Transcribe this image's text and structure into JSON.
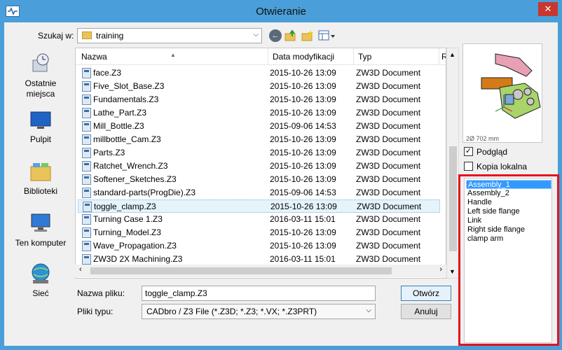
{
  "window": {
    "title": "Otwieranie",
    "close_glyph": "✕",
    "icon": "zw3d-app-icon"
  },
  "toolbar": {
    "look_in_label": "Szukaj w:",
    "look_in_value": "training"
  },
  "places": [
    {
      "label": "Ostatnie\nmiejsca",
      "icon": "recent-places-icon"
    },
    {
      "label": "Pulpit",
      "icon": "desktop-icon"
    },
    {
      "label": "Biblioteki",
      "icon": "libraries-icon"
    },
    {
      "label": "Ten komputer",
      "icon": "computer-icon"
    },
    {
      "label": "Sieć",
      "icon": "network-icon"
    }
  ],
  "file_list": {
    "columns": [
      "Nazwa",
      "Data modyfikacji",
      "Typ",
      "R"
    ],
    "rows": [
      {
        "name": "face.Z3",
        "date": "2015-10-26 13:09",
        "type": "ZW3D Document"
      },
      {
        "name": "Five_Slot_Base.Z3",
        "date": "2015-10-26 13:09",
        "type": "ZW3D Document"
      },
      {
        "name": "Fundamentals.Z3",
        "date": "2015-10-26 13:09",
        "type": "ZW3D Document"
      },
      {
        "name": "Lathe_Part.Z3",
        "date": "2015-10-26 13:09",
        "type": "ZW3D Document"
      },
      {
        "name": "Mill_Bottle.Z3",
        "date": "2015-09-06 14:53",
        "type": "ZW3D Document"
      },
      {
        "name": "millbottle_Cam.Z3",
        "date": "2015-10-26 13:09",
        "type": "ZW3D Document"
      },
      {
        "name": "Parts.Z3",
        "date": "2015-10-26 13:09",
        "type": "ZW3D Document"
      },
      {
        "name": "Ratchet_Wrench.Z3",
        "date": "2015-10-26 13:09",
        "type": "ZW3D Document"
      },
      {
        "name": "Softener_Sketches.Z3",
        "date": "2015-10-26 13:09",
        "type": "ZW3D Document"
      },
      {
        "name": "standard-parts(ProgDie).Z3",
        "date": "2015-09-06 14:53",
        "type": "ZW3D Document"
      },
      {
        "name": "toggle_clamp.Z3",
        "date": "2015-10-26 13:09",
        "type": "ZW3D Document",
        "selected": true
      },
      {
        "name": "Turning Case 1.Z3",
        "date": "2016-03-11 15:01",
        "type": "ZW3D Document"
      },
      {
        "name": "Turning_Model.Z3",
        "date": "2015-10-26 13:09",
        "type": "ZW3D Document"
      },
      {
        "name": "Wave_Propagation.Z3",
        "date": "2015-10-26 13:09",
        "type": "ZW3D Document"
      },
      {
        "name": "ZW3D 2X Machining.Z3",
        "date": "2016-03-11 15:01",
        "type": "ZW3D Document"
      }
    ]
  },
  "form": {
    "filename_label": "Nazwa pliku:",
    "filename_value": "toggle_clamp.Z3",
    "filetype_label": "Pliki typu:",
    "filetype_value": "CADbro / Z3 File (*.Z3D; *.Z3; *.VX; *.Z3PRT)",
    "open_button": "Otwórz",
    "cancel_button": "Anuluj"
  },
  "preview_panel": {
    "caption": "2Ø 702 mm",
    "preview_checkbox_label": "Podgląd",
    "preview_checked": true,
    "local_copy_label": "Kopia lokalna",
    "local_copy_checked": false,
    "parts": [
      {
        "name": "Assembly_1",
        "selected": true
      },
      {
        "name": "Assembly_2"
      },
      {
        "name": "Handle"
      },
      {
        "name": "Left side flange"
      },
      {
        "name": "Link"
      },
      {
        "name": "Right side flange"
      },
      {
        "name": "clamp arm"
      }
    ]
  },
  "colors": {
    "titlebar": "#4a9ed9",
    "close": "#c7372f",
    "highlight_frame": "#e3141c",
    "selection": "#3399ff"
  }
}
